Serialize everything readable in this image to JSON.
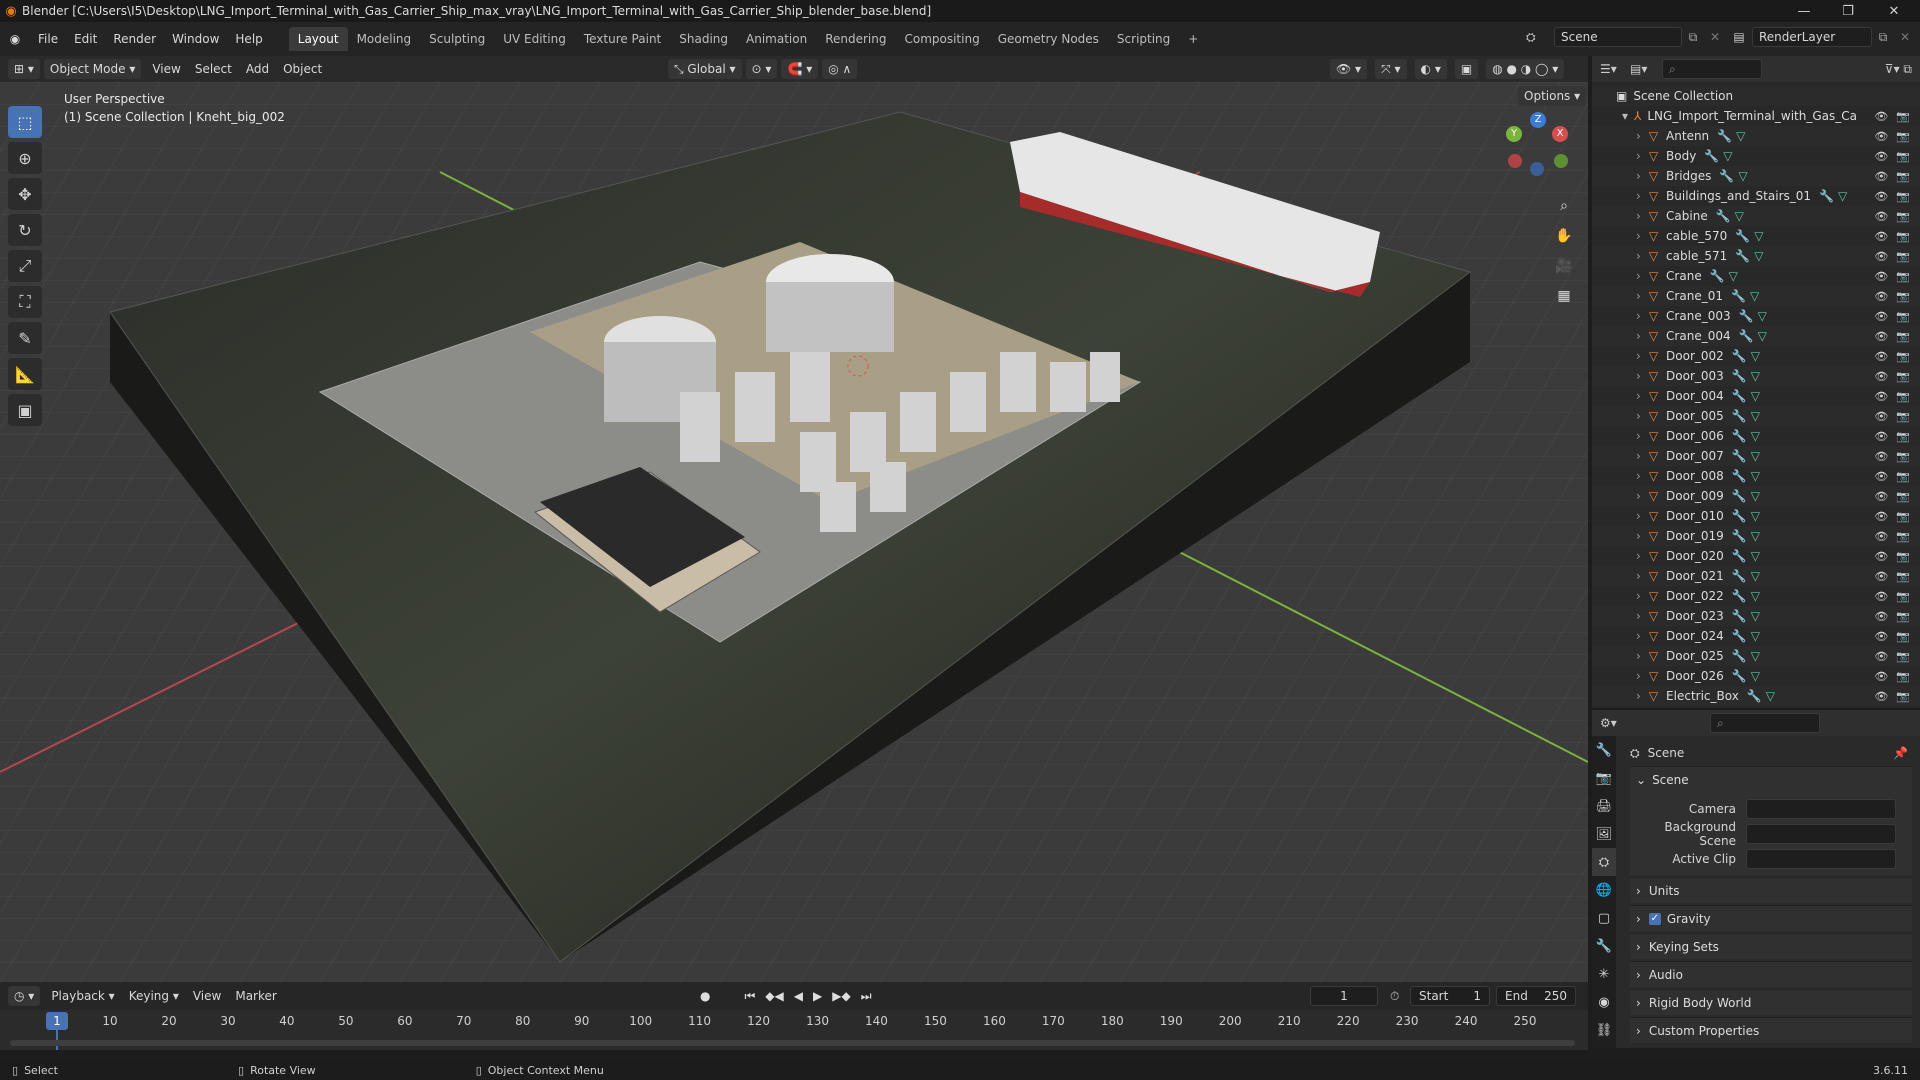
{
  "window": {
    "title": "Blender [C:\\Users\\I5\\Desktop\\LNG_Import_Terminal_with_Gas_Carrier_Ship_max_vray\\LNG_Import_Terminal_with_Gas_Carrier_Ship_blender_base.blend]"
  },
  "menu": [
    "File",
    "Edit",
    "Render",
    "Window",
    "Help"
  ],
  "workspaces": [
    "Layout",
    "Modeling",
    "Sculpting",
    "UV Editing",
    "Texture Paint",
    "Shading",
    "Animation",
    "Rendering",
    "Compositing",
    "Geometry Nodes",
    "Scripting"
  ],
  "active_workspace": "Layout",
  "scene_name": "Scene",
  "view_layer": "RenderLayer",
  "viewport_header": {
    "mode": "Object Mode",
    "view": "View",
    "select": "Select",
    "add": "Add",
    "object": "Object",
    "orientation": "Global",
    "options": "Options"
  },
  "viewport_overlay": {
    "line1": "User Perspective",
    "line2": "(1) Scene Collection | Kneht_big_002"
  },
  "outliner": {
    "root": "Scene Collection",
    "collection": "LNG_Import_Terminal_with_Gas_Carrier",
    "items": [
      "Antenn",
      "Body",
      "Bridges",
      "Buildings_and_Stairs_01",
      "Cabine",
      "cable_570",
      "cable_571",
      "Crane",
      "Crane_01",
      "Crane_003",
      "Crane_004",
      "Door_002",
      "Door_003",
      "Door_004",
      "Door_005",
      "Door_006",
      "Door_007",
      "Door_008",
      "Door_009",
      "Door_010",
      "Door_019",
      "Door_020",
      "Door_021",
      "Door_022",
      "Door_023",
      "Door_024",
      "Door_025",
      "Door_026",
      "Electric_Box"
    ]
  },
  "properties": {
    "context_title": "Scene",
    "section_scene": "Scene",
    "camera_label": "Camera",
    "background_scene_label": "Background Scene",
    "active_clip_label": "Active Clip",
    "panels": [
      "Units",
      "Gravity",
      "Keying Sets",
      "Audio",
      "Rigid Body World",
      "Custom Properties"
    ]
  },
  "timeline": {
    "playback": "Playback",
    "keying": "Keying",
    "view": "View",
    "marker": "Marker",
    "current_frame": "1",
    "start_label": "Start",
    "start": "1",
    "end_label": "End",
    "end": "250",
    "ticks": [
      "1",
      "10",
      "20",
      "30",
      "40",
      "50",
      "60",
      "70",
      "80",
      "90",
      "100",
      "110",
      "120",
      "130",
      "140",
      "150",
      "160",
      "170",
      "180",
      "190",
      "200",
      "210",
      "220",
      "230",
      "240",
      "250"
    ]
  },
  "status": {
    "select": "Select",
    "rotate": "Rotate View",
    "context_menu": "Object Context Menu",
    "version": "3.6.11"
  },
  "colors": {
    "accent": "#4772b3",
    "object_orange": "#e8873a",
    "mesh_green": "#63c19f"
  }
}
